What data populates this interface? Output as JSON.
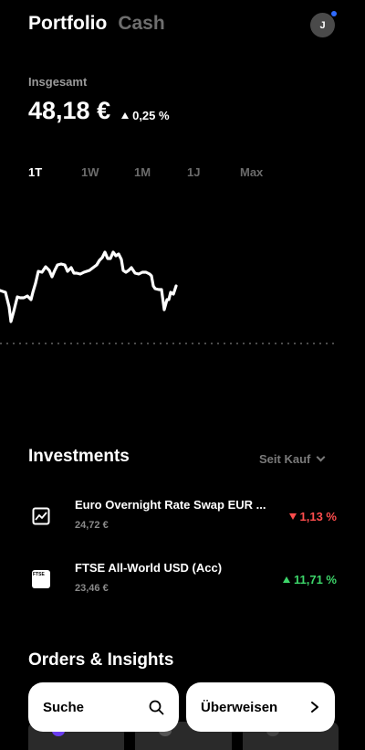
{
  "header": {
    "tab_portfolio": "Portfolio",
    "tab_cash": "Cash"
  },
  "avatar": {
    "initial": "J",
    "notification_color": "#2f6bff"
  },
  "summary": {
    "label": "Insgesamt",
    "value": "48,18 €",
    "change": "0,25 %"
  },
  "ranges": [
    "1T",
    "1W",
    "1M",
    "1J",
    "Max"
  ],
  "investments": {
    "title": "Investments",
    "filter": "Seit Kauf",
    "items": [
      {
        "name": "Euro Overnight Rate Swap EUR ...",
        "value": "24,72 €",
        "change": "1,13 %",
        "direction": "down",
        "icon": "chart-line-icon"
      },
      {
        "name": "FTSE All-World USD (Acc)",
        "value": "23,46 €",
        "change": "11,71 %",
        "direction": "up",
        "icon": "ftse-logo"
      }
    ]
  },
  "orders": {
    "title": "Orders & Insights"
  },
  "buttons": {
    "search": "Suche",
    "transfer": "Überweisen"
  },
  "icons": {
    "ftse_badge": "FTSE"
  },
  "colors": {
    "background": "#000000",
    "negative": "#ff4d4d",
    "positive": "#3dd66a"
  }
}
